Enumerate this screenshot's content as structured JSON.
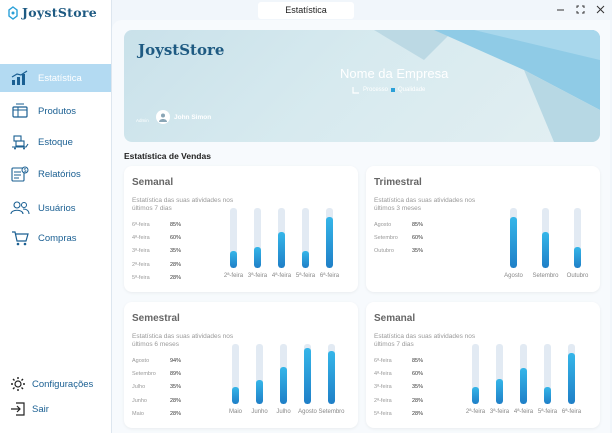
{
  "window": {
    "title": "Estatística"
  },
  "sidebar": {
    "logo": "JoystStore",
    "items": [
      {
        "label": "Estatística",
        "icon": "chart-icon",
        "active": true
      },
      {
        "label": "Produtos",
        "icon": "products-icon"
      },
      {
        "label": "Estoque",
        "icon": "stock-icon"
      },
      {
        "label": "Relatórios",
        "icon": "reports-icon"
      },
      {
        "label": "Usuários",
        "icon": "users-icon"
      },
      {
        "label": "Compras",
        "icon": "cart-icon"
      }
    ],
    "settings_label": "Configurações",
    "logout_label": "Sair"
  },
  "banner": {
    "logo": "JoystStore",
    "company": "Nome da Empresa",
    "subtitle_a": "Processo",
    "subtitle_b": "Qualidade",
    "role": "Admin",
    "user": "John Simon"
  },
  "section_title": "Estatística de Vendas",
  "cards": [
    {
      "title": "Semanal",
      "desc": "Estatística das suas atividades nos últimos 7 dias",
      "rows": [
        {
          "label": "6ª-feira",
          "value": "85%"
        },
        {
          "label": "4ª-feira",
          "value": "60%"
        },
        {
          "label": "3ª-feira",
          "value": "35%"
        },
        {
          "label": "2ª-feira",
          "value": "28%"
        },
        {
          "label": "5ª-feira",
          "value": "28%"
        }
      ],
      "bars": [
        {
          "label": "2ª-feira",
          "value": 28
        },
        {
          "label": "3ª-feira",
          "value": 35
        },
        {
          "label": "4ª-feira",
          "value": 60
        },
        {
          "label": "5ª-feira",
          "value": 28
        },
        {
          "label": "6ª-feira",
          "value": 85
        }
      ]
    },
    {
      "title": "Trimestral",
      "desc": "Estatística das suas atividades nos últimos 3 meses",
      "rows": [
        {
          "label": "Agosto",
          "value": "85%"
        },
        {
          "label": "Setembro",
          "value": "60%"
        },
        {
          "label": "Outubro",
          "value": "35%"
        }
      ],
      "bars": [
        {
          "label": "Agosto",
          "value": 85
        },
        {
          "label": "Setembro",
          "value": 60
        },
        {
          "label": "Outubro",
          "value": 35
        }
      ]
    },
    {
      "title": "Semestral",
      "desc": "Estatística das suas atividades nos últimos 6 meses",
      "rows": [
        {
          "label": "Agosto",
          "value": "94%"
        },
        {
          "label": "Setembro",
          "value": "89%"
        },
        {
          "label": "Julho",
          "value": "35%"
        },
        {
          "label": "Junho",
          "value": "28%"
        },
        {
          "label": "Maio",
          "value": "28%"
        }
      ],
      "bars": [
        {
          "label": "Maio",
          "value": 28
        },
        {
          "label": "Junho",
          "value": 40
        },
        {
          "label": "Julho",
          "value": 62
        },
        {
          "label": "Agosto",
          "value": 94
        },
        {
          "label": "Setembro",
          "value": 89
        }
      ]
    },
    {
      "title": "Semanal",
      "desc": "Estatística das suas atividades nos últimos 7 dias",
      "rows": [
        {
          "label": "6ª-feira",
          "value": "85%"
        },
        {
          "label": "4ª-feira",
          "value": "60%"
        },
        {
          "label": "3ª-feira",
          "value": "35%"
        },
        {
          "label": "2ª-feira",
          "value": "28%"
        },
        {
          "label": "5ª-feira",
          "value": "28%"
        }
      ],
      "bars": [
        {
          "label": "2ª-feira",
          "value": 28
        },
        {
          "label": "3ª-feira",
          "value": 42
        },
        {
          "label": "4ª-feira",
          "value": 60
        },
        {
          "label": "5ª-feira",
          "value": 28
        },
        {
          "label": "6ª-feira",
          "value": 85
        }
      ]
    }
  ],
  "colors": {
    "accent": "#1f7fc7",
    "active_bg": "#b3daf2",
    "nav_text": "#1a5f92"
  }
}
